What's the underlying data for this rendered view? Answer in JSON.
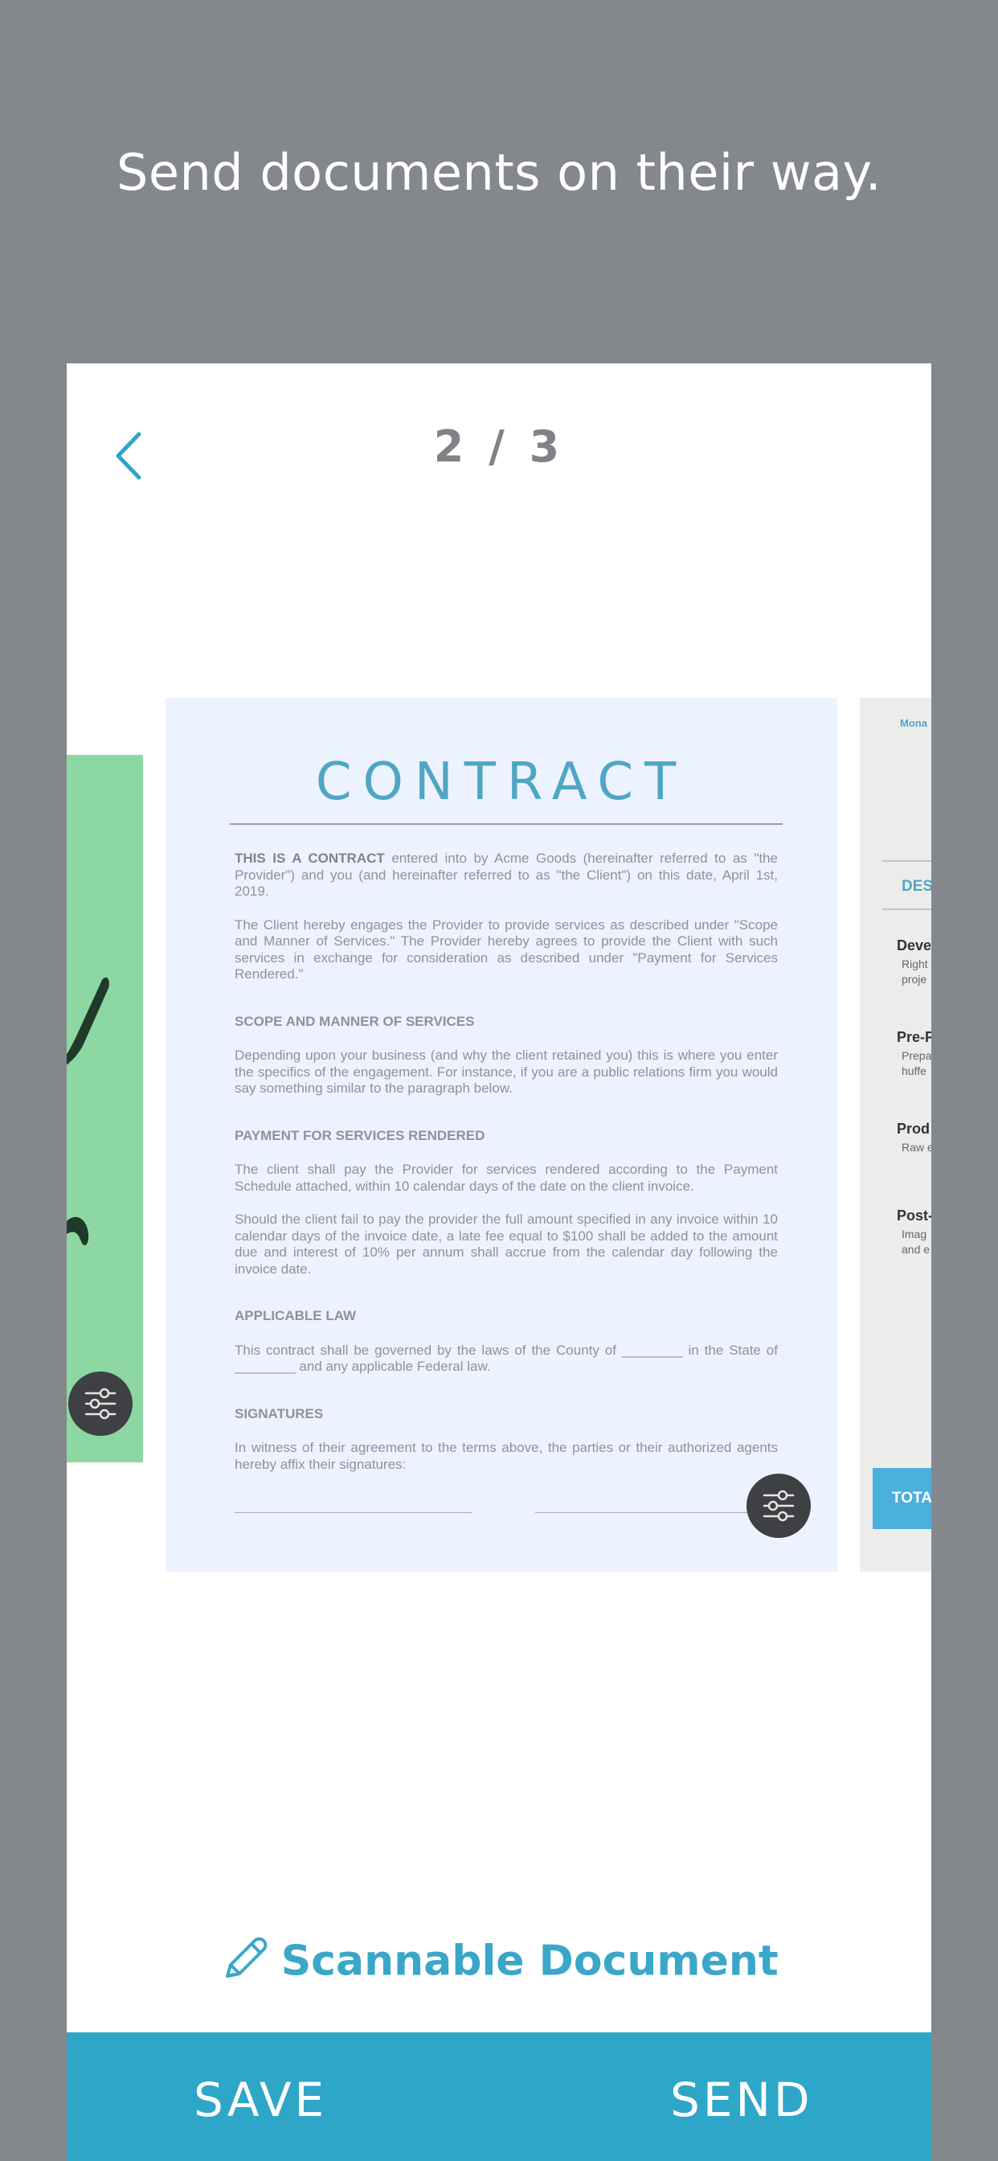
{
  "headline": "Send documents on their way.",
  "pager": {
    "current": 2,
    "total": 3,
    "label": "2 / 3"
  },
  "pages": {
    "center": {
      "title": "CONTRACT",
      "intro_bold": "THIS IS A CONTRACT",
      "intro_rest": " entered into by Acme Goods (hereinafter referred to as \"the Provider\") and you (and hereinafter referred to as \"the Client\") on this date, April 1st, 2019.",
      "para2": "The Client hereby engages the Provider to provide services as described under \"Scope and Manner of Services.\" The Provider hereby agrees to provide the Client with such services in exchange for consideration as described under \"Payment for Services Rendered.\"",
      "h_scope": "SCOPE AND MANNER OF SERVICES",
      "scope_text": "Depending upon your business (and why the client retained you) this is where you enter the specifics of the engagement. For instance, if you are a public relations firm you would say something similar to the paragraph below.",
      "h_payment": "PAYMENT FOR SERVICES RENDERED",
      "payment_text1": "The client shall pay the Provider for services rendered according to the Payment Schedule attached, within 10 calendar days of the date on the client invoice.",
      "payment_text2": "Should the client fail to pay the provider the full amount specified in any invoice within 10 calendar days of the invoice date, a late fee equal to $100 shall be added to the amount due and interest of 10% per annum shall accrue from the calendar day following the invoice date.",
      "h_law": "APPLICABLE LAW",
      "law_text": "This contract shall be governed by the laws of the County of ________ in the State of ________ and any applicable Federal law.",
      "h_signatures": "SIGNATURES",
      "signatures_text": "In witness of their agreement to the terms above, the parties or their authorized agents hereby affix their signatures:"
    },
    "right": {
      "brand": "Mona",
      "desc_header": "DESC",
      "items": [
        {
          "title": "Deve",
          "sub1": "Right",
          "sub2": "proje"
        },
        {
          "title": "Pre-F",
          "sub1": "Prepa",
          "sub2": "huffe"
        },
        {
          "title": "Prod",
          "sub1": "Raw e",
          "sub2": ""
        },
        {
          "title": "Post-",
          "sub1": "Imag",
          "sub2": "and e"
        }
      ],
      "total_label": "TOTAL"
    }
  },
  "document_type": {
    "label": "Scannable Document",
    "icon": "pencil-icon"
  },
  "actions": {
    "save": "SAVE",
    "send": "SEND"
  },
  "colors": {
    "accent": "#2ea6c8",
    "background": "#84878c",
    "doc_title": "#4fa6c4",
    "left_page": "#8dd8a2"
  }
}
